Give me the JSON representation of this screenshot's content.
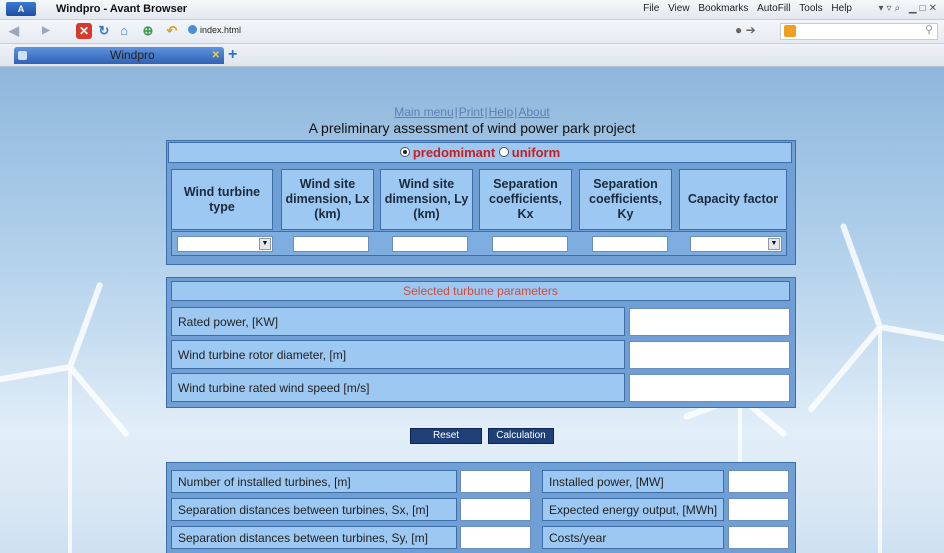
{
  "browser": {
    "title": "Windpro - Avant Browser",
    "logo": "A",
    "menu": [
      "File",
      "View",
      "Bookmarks",
      "AutoFill",
      "Tools",
      "Help"
    ],
    "address": "index.html",
    "tab_label": "Windpro"
  },
  "page": {
    "links": [
      "Main menu",
      "Print",
      "Help",
      "About"
    ],
    "heading": "A preliminary assessment of wind power park project",
    "radio": {
      "option1": "predomimant",
      "option2": "uniform",
      "selected": "predomimant"
    },
    "columns": [
      "Wind turbine type",
      "Wind site dimension, Lx (km)",
      "Wind site dimension, Ly (km)",
      "Separation coefficients, Kx",
      "Separation coefficients, Ky",
      "Capacity factor"
    ],
    "params": {
      "title": "Selected turbune parameters",
      "rows": [
        "Rated power, [KW]",
        "Wind turbine rotor diameter, [m]",
        "Wind turbine rated wind speed [m/s]"
      ]
    },
    "buttons": {
      "reset": "Reset",
      "calculation": "Calculation"
    },
    "results_left": [
      "Number of installed turbines, [m]",
      "Separation distances between turbines, Sx, [m]",
      "Separation distances between turbines, Sy, [m]"
    ],
    "results_right": [
      "Installed power, [MW]",
      "Expected energy output, [MWh]",
      "Costs/year"
    ]
  },
  "colors": {
    "panel": "#6f9fd4",
    "cell": "#9cc8f2",
    "button": "#1f3f78",
    "radio_text": "#c81e1e"
  }
}
